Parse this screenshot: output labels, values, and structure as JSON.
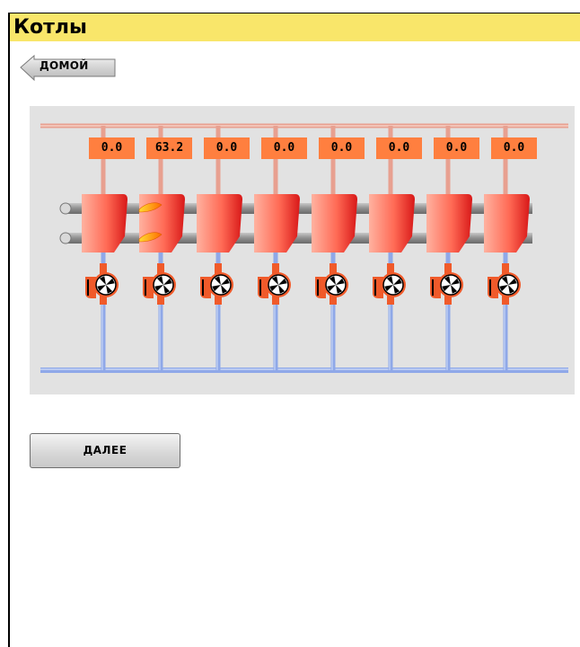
{
  "header": {
    "title": "Котлы"
  },
  "nav": {
    "home_label": "ДОМОЙ"
  },
  "boilers": [
    {
      "value": "0.0",
      "burning": false
    },
    {
      "value": "63.2",
      "burning": true
    },
    {
      "value": "0.0",
      "burning": false
    },
    {
      "value": "0.0",
      "burning": false
    },
    {
      "value": "0.0",
      "burning": false
    },
    {
      "value": "0.0",
      "burning": false
    },
    {
      "value": "0.0",
      "burning": false
    },
    {
      "value": "0.0",
      "burning": false
    }
  ],
  "footer": {
    "next_label": "ДАЛЕЕ"
  },
  "colors": {
    "header_bg": "#f9e66a",
    "supply_pipe": "#e8a090",
    "return_pipe": "#8fa8e8",
    "boiler": "#ff6a55",
    "readout_bg": "#ff7f3f",
    "pump": "#f05a2a",
    "panel_bg": "#e2e2e2"
  }
}
